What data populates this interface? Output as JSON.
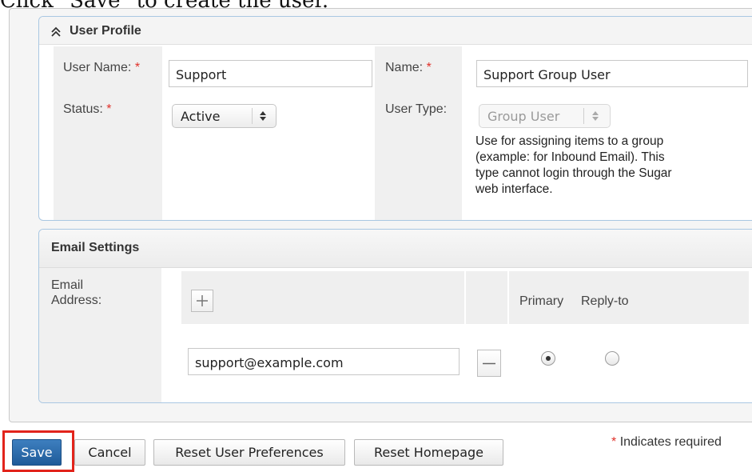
{
  "instruction": "Click \"Save\" to create the user.",
  "user_profile": {
    "title": "User Profile",
    "fields": {
      "user_name": {
        "label": "User Name:",
        "required": "*",
        "value": "Support"
      },
      "name": {
        "label": "Name:",
        "required": "*",
        "value": "Support Group User"
      },
      "status": {
        "label": "Status:",
        "required": "*",
        "value": "Active"
      },
      "user_type": {
        "label": "User Type:",
        "value": "Group User",
        "help_lines": [
          "Use for assigning items to a group",
          "(example: for Inbound Email). This",
          "type cannot login through the Sugar",
          "web interface."
        ]
      }
    }
  },
  "email_settings": {
    "title": "Email Settings",
    "label_lines": [
      "Email",
      "Address:"
    ],
    "columns": {
      "primary": "Primary",
      "reply_to": "Reply-to"
    },
    "address": "support@example.com",
    "primary_selected": true,
    "reply_to_selected": false
  },
  "actions": {
    "save": "Save",
    "cancel": "Cancel",
    "reset_prefs": "Reset User Preferences",
    "reset_home": "Reset Homepage"
  },
  "footer": {
    "required_mark": "*",
    "required_note": "Indicates required"
  },
  "icons": {
    "collapse": "double-chevron-up-icon",
    "add": "plus-icon",
    "remove": "minus-icon",
    "select": "updown-arrow-icon"
  },
  "colors": {
    "accent": "#2a69a8",
    "required": "#e0312a",
    "highlight": "#e2241b"
  }
}
